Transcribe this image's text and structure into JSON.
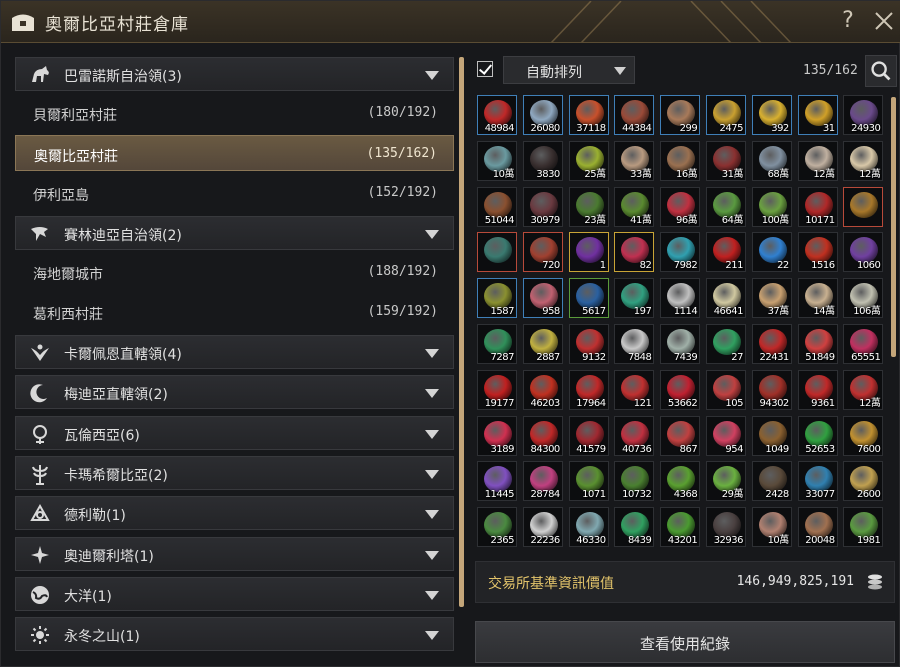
{
  "window": {
    "title": "奧爾比亞村莊倉庫",
    "help": "?"
  },
  "regions": [
    {
      "label": "巴雷諾斯自治領(3)",
      "icon": "horse-icon",
      "towns": [
        {
          "name": "貝爾利亞村莊",
          "count": "(180/192)"
        },
        {
          "name": "奧爾比亞村莊",
          "count": "(135/162)",
          "selected": true
        },
        {
          "name": "伊利亞島",
          "count": "(152/192)"
        }
      ]
    },
    {
      "label": "賽林迪亞自治領(2)",
      "icon": "eagle-icon",
      "towns": [
        {
          "name": "海地爾城市",
          "count": "(188/192)"
        },
        {
          "name": "葛利西村莊",
          "count": "(159/192)"
        }
      ]
    },
    {
      "label": "卡爾佩恩直轄領(4)",
      "icon": "wings-icon",
      "towns": []
    },
    {
      "label": "梅迪亞直轄領(2)",
      "icon": "moon-icon",
      "towns": []
    },
    {
      "label": "瓦倫西亞(6)",
      "icon": "emblem-icon",
      "towns": []
    },
    {
      "label": "卡瑪希爾比亞(2)",
      "icon": "tree-icon",
      "towns": []
    },
    {
      "label": "德利勒(1)",
      "icon": "knot-icon",
      "towns": []
    },
    {
      "label": "奧迪爾利塔(1)",
      "icon": "star-icon",
      "towns": []
    },
    {
      "label": "大洋(1)",
      "icon": "globe-icon",
      "towns": []
    },
    {
      "label": "永冬之山(1)",
      "icon": "sun-icon",
      "towns": []
    }
  ],
  "toolbar": {
    "auto_sort_label": "自動排列",
    "auto_sort_checked": true,
    "slot_count": "135/162"
  },
  "items": [
    {
      "q": "48984",
      "c": "#c02828",
      "b": "blue"
    },
    {
      "q": "26080",
      "c": "#8fa8c0",
      "b": "blue"
    },
    {
      "q": "37118",
      "c": "#c8502c",
      "b": "blue"
    },
    {
      "q": "44384",
      "c": "#9a4a38",
      "b": "blue"
    },
    {
      "q": "299",
      "c": "#a87a5a",
      "b": "blue"
    },
    {
      "q": "2475",
      "c": "#c9a030",
      "b": "blue"
    },
    {
      "q": "392",
      "c": "#d8b030",
      "b": "blue"
    },
    {
      "q": "31",
      "c": "#d0a028",
      "b": "blue"
    },
    {
      "q": "24930",
      "c": "#6a4a8a",
      "b": "none"
    },
    {
      "q": "10萬",
      "c": "#6a9aa0",
      "b": "none"
    },
    {
      "q": "3830",
      "c": "#3a3030",
      "b": "none"
    },
    {
      "q": "25萬",
      "c": "#9ab030",
      "b": "none"
    },
    {
      "q": "33萬",
      "c": "#b89a80",
      "b": "none"
    },
    {
      "q": "16萬",
      "c": "#9a7050",
      "b": "none"
    },
    {
      "q": "31萬",
      "c": "#8a3030",
      "b": "none"
    },
    {
      "q": "68萬",
      "c": "#8090a0",
      "b": "none"
    },
    {
      "q": "12萬",
      "c": "#c0b0a0",
      "b": "none"
    },
    {
      "q": "12萬",
      "c": "#d8c8a8",
      "b": "none"
    },
    {
      "q": "51044",
      "c": "#8a5030",
      "b": "none"
    },
    {
      "q": "30979",
      "c": "#6a3a40",
      "b": "none"
    },
    {
      "q": "23萬",
      "c": "#4a7a30",
      "b": "none"
    },
    {
      "q": "41萬",
      "c": "#5a8a30",
      "b": "none"
    },
    {
      "q": "96萬",
      "c": "#c03040",
      "b": "none"
    },
    {
      "q": "64萬",
      "c": "#5a9a40",
      "b": "none"
    },
    {
      "q": "100萬",
      "c": "#6aa040",
      "b": "none"
    },
    {
      "q": "10171",
      "c": "#b02828",
      "b": "none"
    },
    {
      "q": "",
      "c": "#a8782a",
      "b": "red"
    },
    {
      "q": "",
      "c": "#3a7a70",
      "b": "red"
    },
    {
      "q": "720",
      "c": "#a04030",
      "b": "red"
    },
    {
      "q": "1",
      "c": "#7030a0",
      "b": "yellow"
    },
    {
      "q": "82",
      "c": "#c03050",
      "b": "yellow"
    },
    {
      "q": "7982",
      "c": "#30a0b0",
      "b": "none"
    },
    {
      "q": "211",
      "c": "#c02020",
      "b": "none"
    },
    {
      "q": "22",
      "c": "#3080d0",
      "b": "none"
    },
    {
      "q": "1516",
      "c": "#c03020",
      "b": "none"
    },
    {
      "q": "1060",
      "c": "#7040a0",
      "b": "none"
    },
    {
      "q": "1587",
      "c": "#8a9030",
      "b": "blue"
    },
    {
      "q": "958",
      "c": "#c06070",
      "b": "blue"
    },
    {
      "q": "5617",
      "c": "#2a60a0",
      "b": "green"
    },
    {
      "q": "197",
      "c": "#30a080",
      "b": "none"
    },
    {
      "q": "1114",
      "c": "#c0c0c0",
      "b": "none"
    },
    {
      "q": "46641",
      "c": "#d0c8a0",
      "b": "none"
    },
    {
      "q": "37萬",
      "c": "#c8a070",
      "b": "none"
    },
    {
      "q": "14萬",
      "c": "#c8b090",
      "b": "none"
    },
    {
      "q": "106萬",
      "c": "#c0c0b0",
      "b": "none"
    },
    {
      "q": "7287",
      "c": "#30905a",
      "b": "none"
    },
    {
      "q": "2887",
      "c": "#c0b040",
      "b": "none"
    },
    {
      "q": "9132",
      "c": "#c03030",
      "b": "none"
    },
    {
      "q": "7848",
      "c": "#c8c8c8",
      "b": "none"
    },
    {
      "q": "7439",
      "c": "#a0b0a8",
      "b": "none"
    },
    {
      "q": "27",
      "c": "#30a060",
      "b": "none"
    },
    {
      "q": "22431",
      "c": "#c02828",
      "b": "none"
    },
    {
      "q": "51849",
      "c": "#d04040",
      "b": "none"
    },
    {
      "q": "65551",
      "c": "#c03060",
      "b": "none"
    },
    {
      "q": "19177",
      "c": "#c02020",
      "b": "none"
    },
    {
      "q": "46203",
      "c": "#c03020",
      "b": "none"
    },
    {
      "q": "17964",
      "c": "#c02828",
      "b": "none"
    },
    {
      "q": "121",
      "c": "#c03030",
      "b": "none"
    },
    {
      "q": "53662",
      "c": "#c02030",
      "b": "none"
    },
    {
      "q": "105",
      "c": "#c04040",
      "b": "none"
    },
    {
      "q": "94302",
      "c": "#a03028",
      "b": "none"
    },
    {
      "q": "9361",
      "c": "#c02828",
      "b": "none"
    },
    {
      "q": "12萬",
      "c": "#c03030",
      "b": "none"
    },
    {
      "q": "3189",
      "c": "#d03050",
      "b": "none"
    },
    {
      "q": "84300",
      "c": "#c02828",
      "b": "none"
    },
    {
      "q": "41579",
      "c": "#a02830",
      "b": "none"
    },
    {
      "q": "40736",
      "c": "#c03040",
      "b": "none"
    },
    {
      "q": "867",
      "c": "#c04040",
      "b": "none"
    },
    {
      "q": "954",
      "c": "#d04060",
      "b": "none"
    },
    {
      "q": "1049",
      "c": "#8a6030",
      "b": "none"
    },
    {
      "q": "52653",
      "c": "#30a040",
      "b": "none"
    },
    {
      "q": "7600",
      "c": "#c09030",
      "b": "none"
    },
    {
      "q": "11445",
      "c": "#8050c0",
      "b": "none"
    },
    {
      "q": "28784",
      "c": "#c04080",
      "b": "none"
    },
    {
      "q": "1071",
      "c": "#5a9030",
      "b": "none"
    },
    {
      "q": "10732",
      "c": "#4a8030",
      "b": "none"
    },
    {
      "q": "4368",
      "c": "#5aa030",
      "b": "none"
    },
    {
      "q": "29萬",
      "c": "#6ab040",
      "b": "none"
    },
    {
      "q": "2428",
      "c": "#5a4a3a",
      "b": "none"
    },
    {
      "q": "33077",
      "c": "#3080b0",
      "b": "none"
    },
    {
      "q": "2600",
      "c": "#c0a050",
      "b": "none"
    },
    {
      "q": "2365",
      "c": "#4a8a40",
      "b": "none"
    },
    {
      "q": "22236",
      "c": "#d0d0d0",
      "b": "none"
    },
    {
      "q": "46330",
      "c": "#80a8b0",
      "b": "none"
    },
    {
      "q": "8439",
      "c": "#30a060",
      "b": "none"
    },
    {
      "q": "43201",
      "c": "#4a9a30",
      "b": "none"
    },
    {
      "q": "32936",
      "c": "#4a4040",
      "b": "none"
    },
    {
      "q": "10萬",
      "c": "#b08070",
      "b": "none"
    },
    {
      "q": "20048",
      "c": "#a07050",
      "b": "none"
    },
    {
      "q": "1981",
      "c": "#5a9a40",
      "b": "none"
    }
  ],
  "market": {
    "label": "交易所基準資訊價值",
    "value": "146,949,825,191"
  },
  "history_button": "查看使用紀錄"
}
